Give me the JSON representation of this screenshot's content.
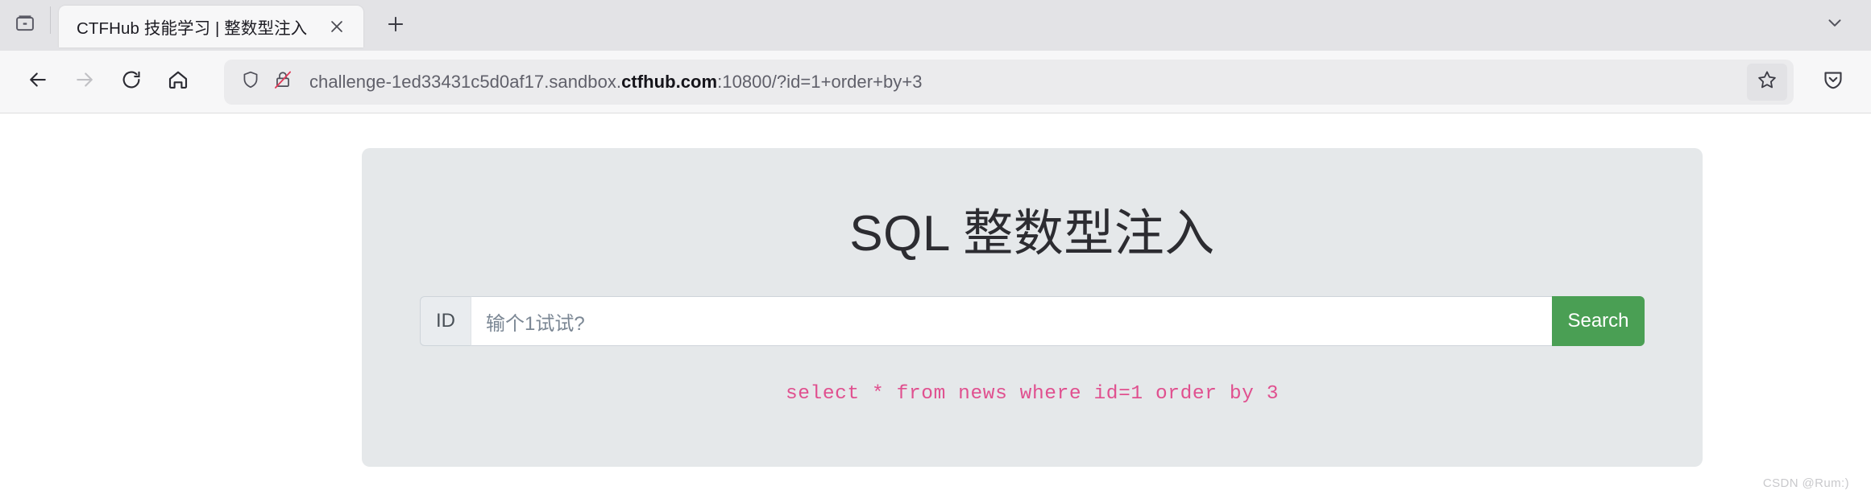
{
  "browser": {
    "tabstrip": {
      "container_icon": "firefox-view-icon",
      "tab": {
        "title": "CTFHub 技能学习 | 整数型注入",
        "close_icon": "close-icon"
      },
      "new_tab_icon": "plus-icon",
      "all_tabs_icon": "chevron-down-icon"
    },
    "navbar": {
      "back_icon": "back-arrow-icon",
      "forward_icon": "forward-arrow-icon",
      "reload_icon": "reload-icon",
      "home_icon": "home-icon",
      "shield_icon": "shield-icon",
      "lock_icon": "lock-crossed-icon",
      "url_prefix": "challenge-1ed33431c5d0af17.sandbox.",
      "url_domain": "ctfhub.com",
      "url_suffix": ":10800/?id=1+order+by+3",
      "url_full": "challenge-1ed33431c5d0af17.sandbox.ctfhub.com:10800/?id=1+order+by+3",
      "bookmark_icon": "star-icon",
      "pocket_icon": "save-to-pocket-icon"
    }
  },
  "page": {
    "title": "SQL 整数型注入",
    "form": {
      "prefix_label": "ID",
      "input_value": "",
      "input_placeholder": "输个1试试?",
      "submit_label": "Search"
    },
    "query_output": "select * from news where id=1 order by 3",
    "colors": {
      "card_bg": "#e5e8ea",
      "button_green": "#4a9f54",
      "sql_pink": "#e0508f"
    }
  },
  "watermark": "CSDN @Rum:)"
}
